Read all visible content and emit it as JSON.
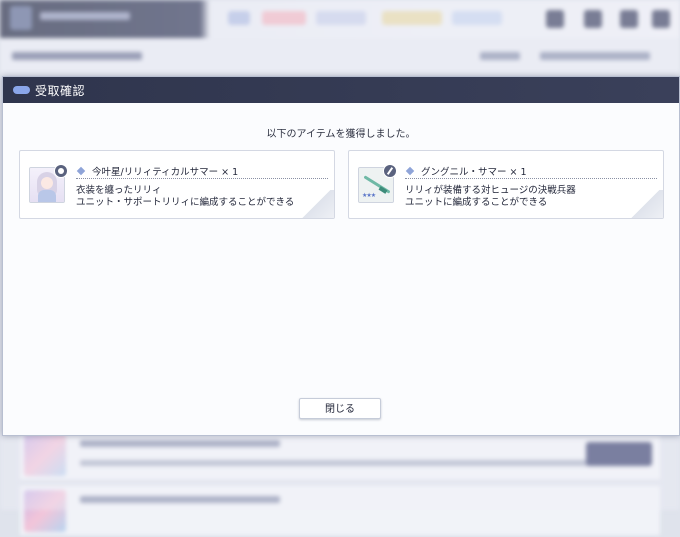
{
  "dialog": {
    "title": "受取確認",
    "message": "以下のアイテムを獲得しました。",
    "close_label": "閉じる"
  },
  "items": [
    {
      "name": "今叶星/リリィティカルサマー × 1",
      "desc_line1": "衣装を纏ったリリィ",
      "desc_line2": "ユニット・サポートリリィに編成することができる",
      "icon": "costume-icon"
    },
    {
      "name": "グングニル・サマー × 1",
      "desc_line1": "リリィが装備する対ヒュージの決戦兵器",
      "desc_line2": "ユニットに編成することができる",
      "icon": "weapon-icon",
      "rarity_stars": "★★★"
    }
  ],
  "colors": {
    "header_bg": "#2f354d",
    "accent": "#8aa6ea",
    "dialog_bg": "#fbfcfe"
  }
}
